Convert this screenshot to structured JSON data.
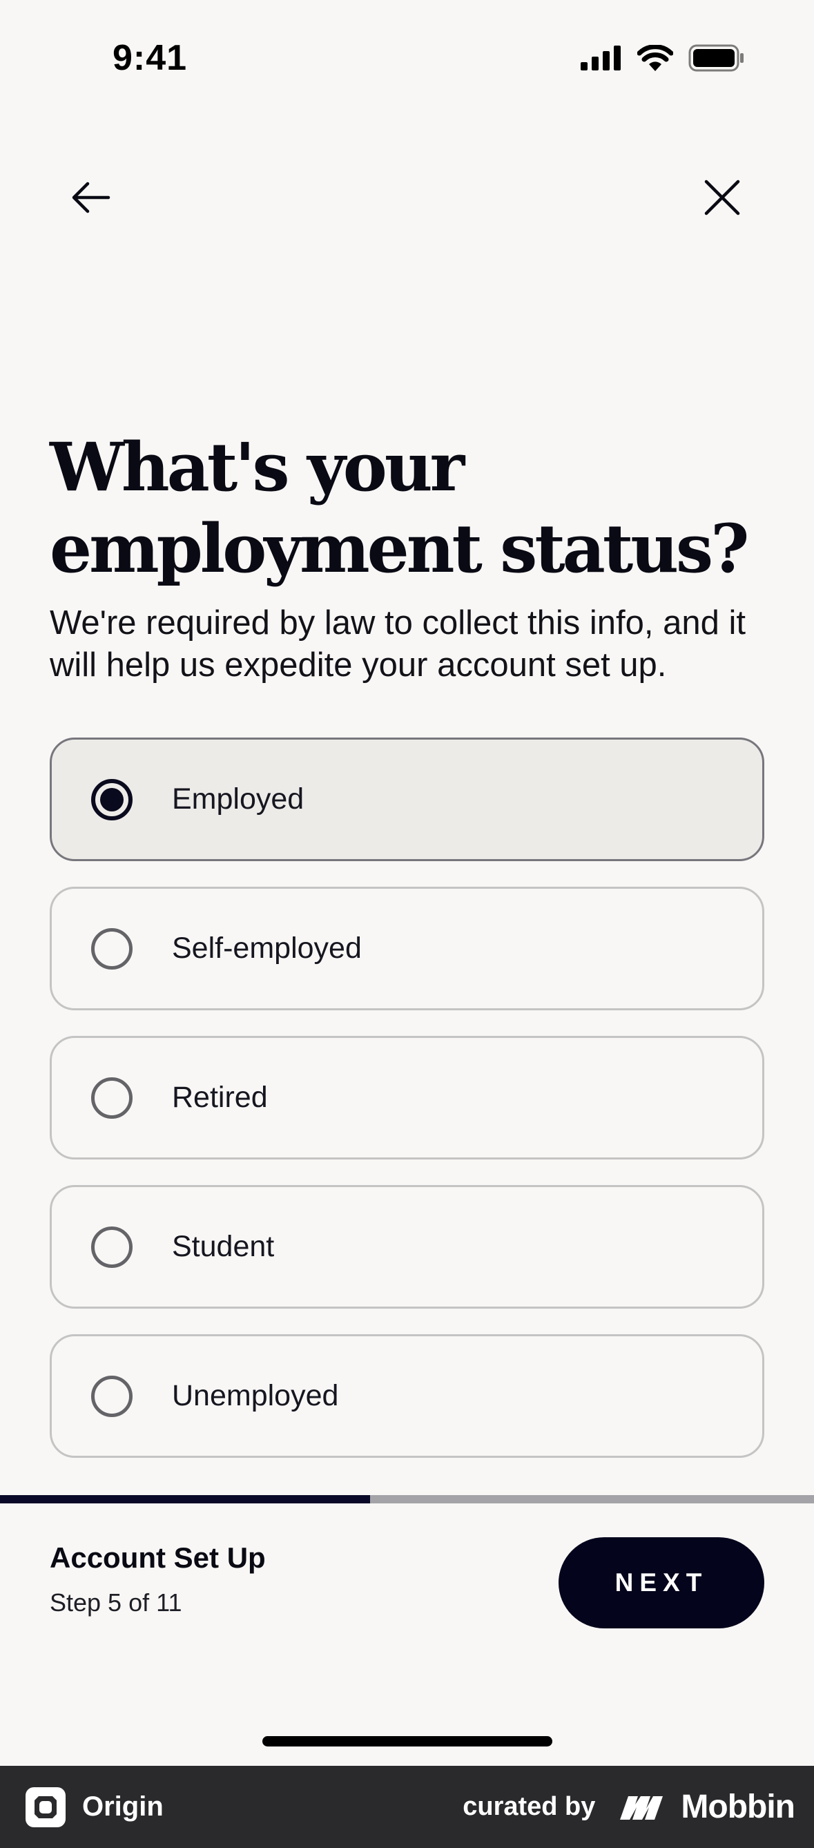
{
  "status_bar": {
    "time": "9:41"
  },
  "header": {
    "back_icon": "arrow-left-icon",
    "close_icon": "close-icon"
  },
  "question": {
    "title": "What's your employment status?",
    "subtitle": "We're required by law to collect this info, and it will help us expedite your account set up."
  },
  "options": [
    {
      "label": "Employed",
      "selected": true
    },
    {
      "label": "Self-employed",
      "selected": false
    },
    {
      "label": "Retired",
      "selected": false
    },
    {
      "label": "Student",
      "selected": false
    },
    {
      "label": "Unemployed",
      "selected": false
    }
  ],
  "progress": {
    "step": 5,
    "total": 11,
    "fraction": 0.4545
  },
  "footer": {
    "title": "Account Set Up",
    "step_text": "Step 5 of 11",
    "next_label": "NEXT"
  },
  "watermark": {
    "app_name": "Origin",
    "curated_by": "curated by",
    "brand": "Mobbin"
  },
  "colors": {
    "primary": "#04041c",
    "background": "#f8f7f5",
    "selected_bg": "#edebe8",
    "border": "#c4c4c4"
  }
}
